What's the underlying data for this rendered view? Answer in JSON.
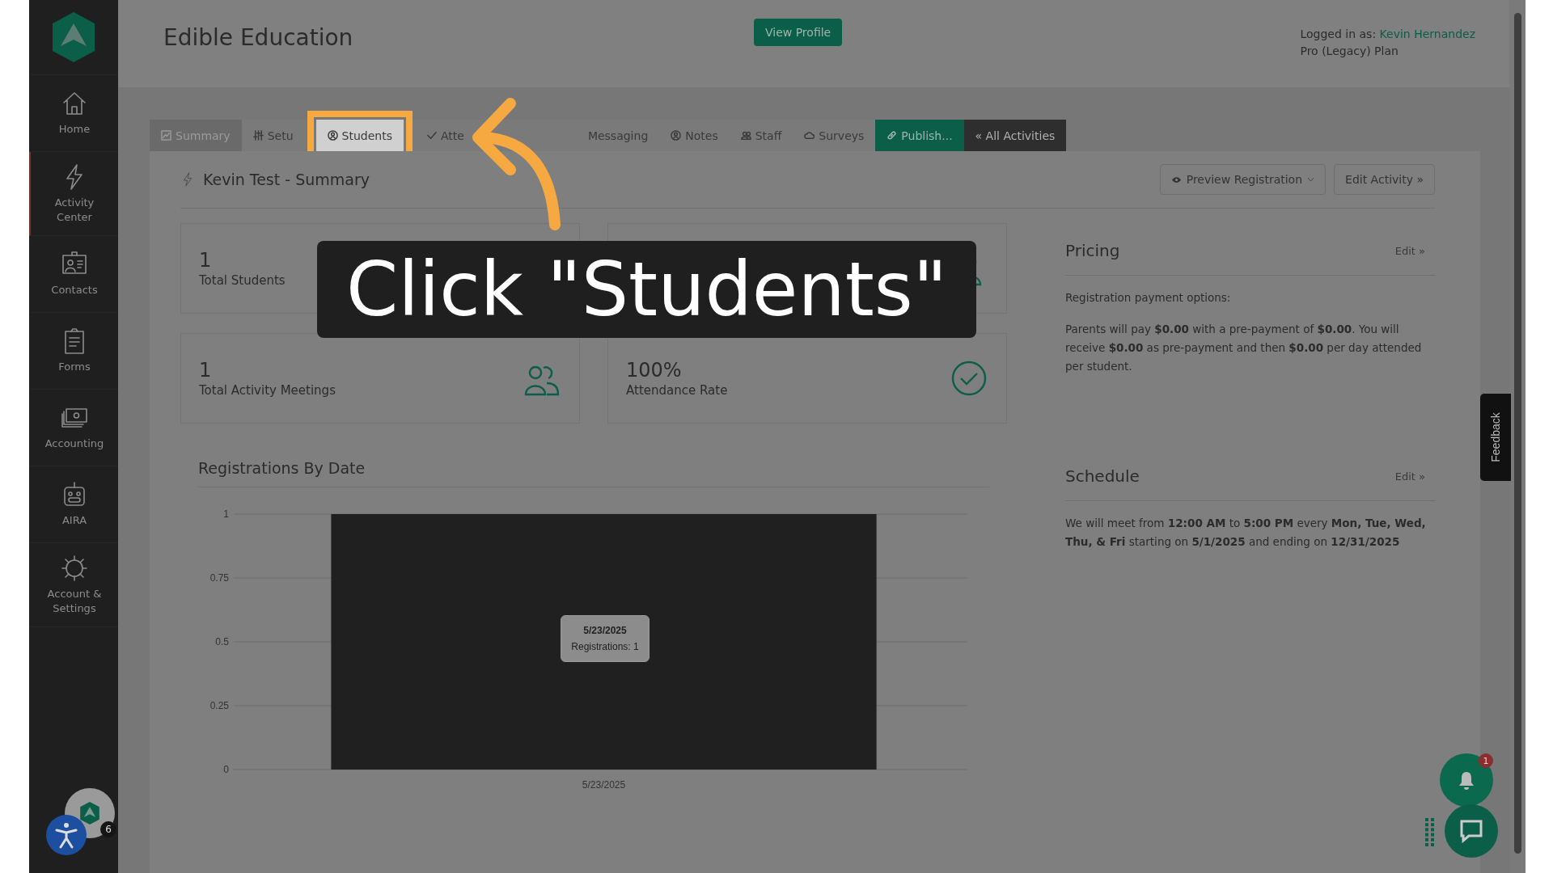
{
  "sidebar": {
    "items": [
      {
        "label": "Home",
        "selected": false
      },
      {
        "label": "Activity Center",
        "selected": true
      },
      {
        "label": "Contacts",
        "selected": false
      },
      {
        "label": "Forms",
        "selected": false
      },
      {
        "label": "Accounting",
        "selected": false
      },
      {
        "label": "AIRA",
        "selected": false
      },
      {
        "label": "Account & Settings",
        "selected": false
      }
    ],
    "accessibility_badge": "6"
  },
  "header": {
    "title": "Edible Education",
    "view_profile": "View Profile",
    "logged_in_label": "Logged in as:",
    "user": "Kevin Hernandez",
    "plan": "Pro (Legacy) Plan"
  },
  "tabs": [
    {
      "label": "Summary",
      "kind": "normal",
      "selected": true,
      "highlighted": false
    },
    {
      "label": "Setu",
      "kind": "normal",
      "selected": false,
      "highlighted": false
    },
    {
      "label": "Students",
      "kind": "normal",
      "selected": false,
      "highlighted": true
    },
    {
      "label": "Atte",
      "kind": "normal",
      "selected": false,
      "highlighted": false
    },
    {
      "label": "Messaging",
      "kind": "normal",
      "selected": false,
      "highlighted": false
    },
    {
      "label": "Notes",
      "kind": "normal",
      "selected": false,
      "highlighted": false
    },
    {
      "label": "Staff",
      "kind": "normal",
      "selected": false,
      "highlighted": false
    },
    {
      "label": "Surveys",
      "kind": "normal",
      "selected": false,
      "highlighted": false
    },
    {
      "label": "Publish...",
      "kind": "publish",
      "selected": false,
      "highlighted": false
    },
    {
      "label": "« All Activities",
      "kind": "dark",
      "selected": false,
      "highlighted": false
    }
  ],
  "page": {
    "title": "Kevin Test - Summary",
    "preview_button": "Preview Registration",
    "edit_button": "Edit Activity »"
  },
  "stats": [
    {
      "value": "1",
      "label": "Total Students"
    },
    {
      "value": "1",
      "label": "Total Activity Meetings"
    },
    {
      "value": "100%",
      "label": "Attendance Rate"
    }
  ],
  "chart": {
    "tooltip_date": "5/23/2025",
    "tooltip_text": "Registrations: 1",
    "chart_data": {
      "type": "bar",
      "title": "Registrations By Date",
      "categories": [
        "5/23/2025"
      ],
      "values": [
        1
      ],
      "ylim": [
        0,
        1
      ],
      "yticks": [
        0,
        0.25,
        0.5,
        0.75,
        1
      ],
      "grid": true
    }
  },
  "pricing": {
    "title": "Pricing",
    "edit": "Edit »",
    "subtitle": "Registration payment options:",
    "text": "Parents will pay **$0.00** with a pre-payment of **$0.00**. You will receive **$0.00** as pre-payment and then **$0.00** per day attended per student."
  },
  "schedule": {
    "title": "Schedule",
    "edit": "Edit »",
    "text": "We will meet from **12:00 AM** to **5:00 PM** every **Mon, Tue, Wed, Thu, & Fri** starting on **5/1/2025** and ending on **12/31/2025**"
  },
  "feedback": "Feedback",
  "notifications_badge": "1",
  "tutorial": {
    "caption": "Click \"Students\""
  }
}
